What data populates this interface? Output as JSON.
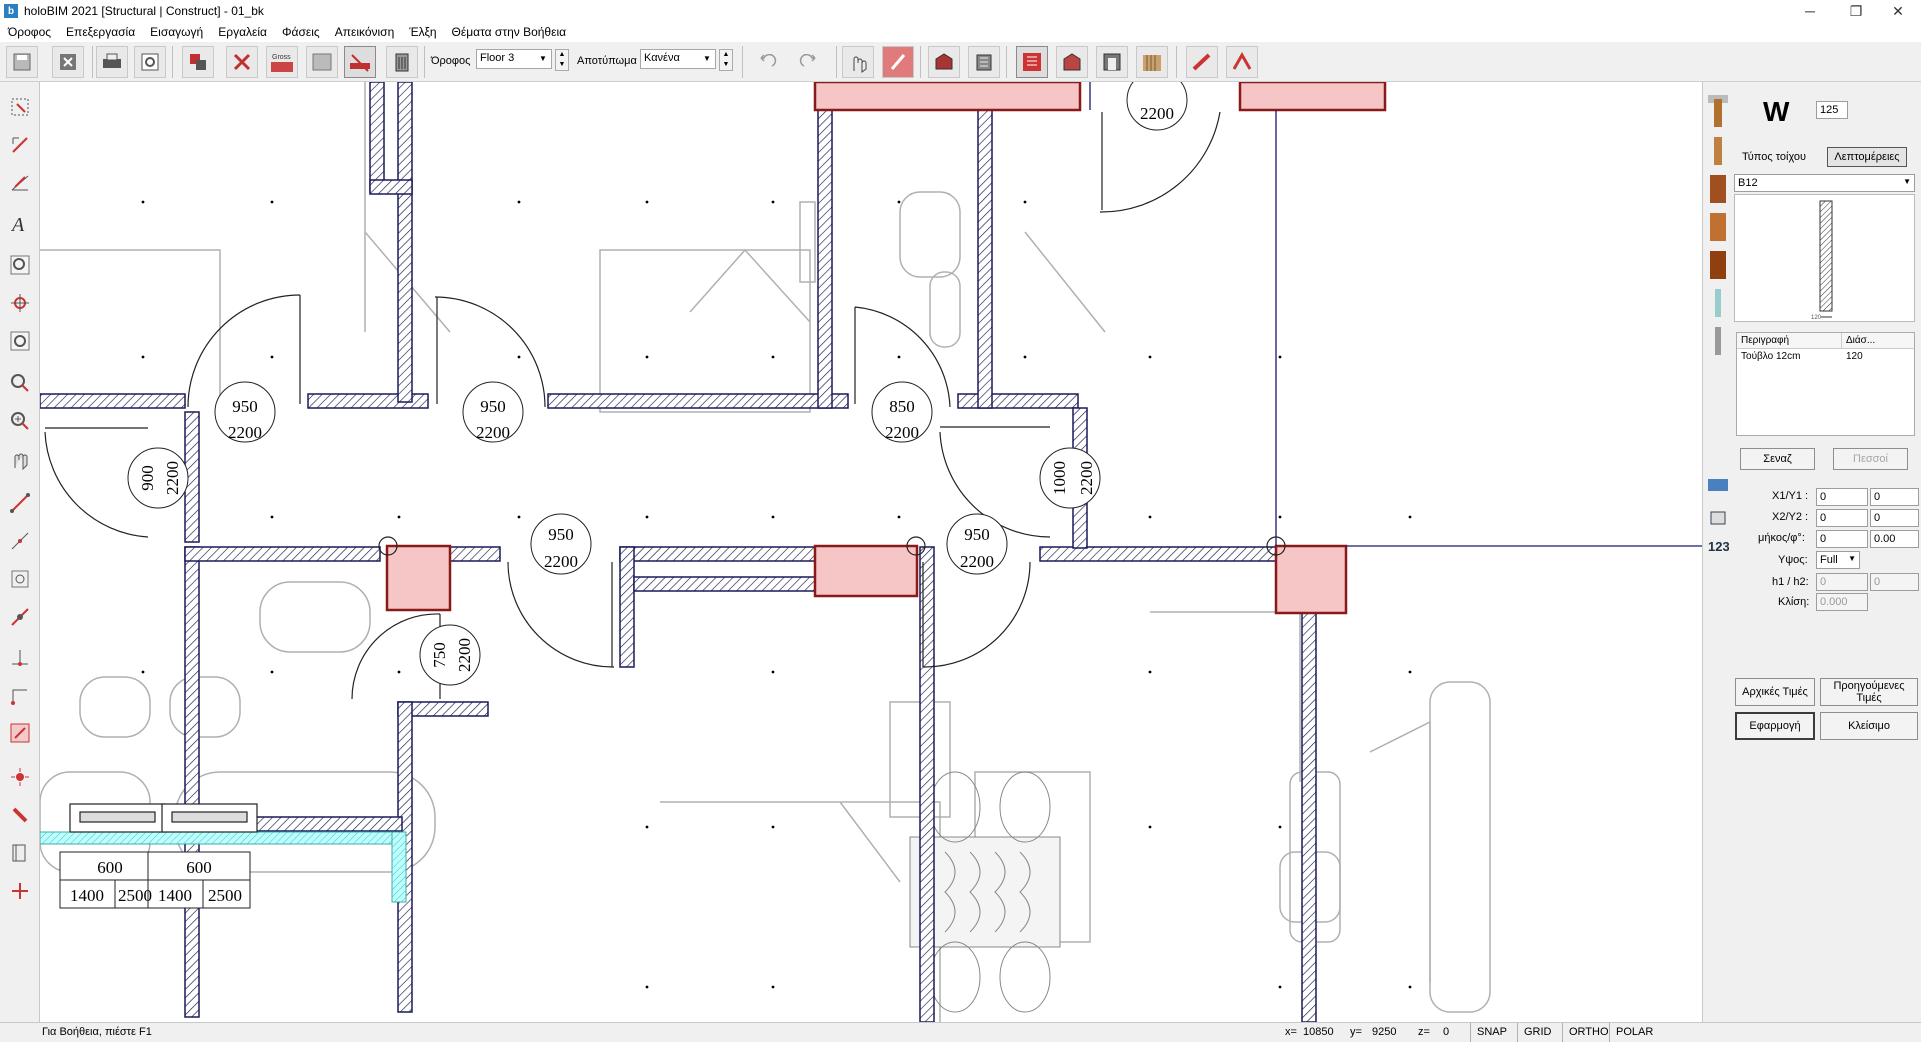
{
  "window": {
    "app_icon": "b",
    "title": "holoBIM 2021 [Structural | Construct] - 01_bk"
  },
  "window_controls": [
    "─",
    "❐",
    "✕"
  ],
  "menu": [
    "Όροφος",
    "Επεξεργασία",
    "Εισαγωγή",
    "Εργαλεία",
    "Φάσεις",
    "Απεικόνιση",
    "Έλξη",
    "Θέματα στην Βοήθεια"
  ],
  "toolbar": {
    "floor_label": "Όροφος",
    "floor_value": "Floor 3",
    "footprint_label": "Αποτύπωμα",
    "footprint_value": "Κανένα",
    "gross_label": "Gross\nBetoni"
  },
  "props": {
    "wall_letter": "W",
    "wall_thickness": "125",
    "wall_type_label": "Τύπος τοίχου",
    "details_button": "Λεπτομέρειες",
    "wall_type_value": "B12",
    "preview_dimension": "120",
    "table_headers": [
      "Περιγραφή",
      "Διάσ..."
    ],
    "table_rows": [
      [
        "Τούβλο 12cm",
        "120"
      ]
    ],
    "layer_button": "Σεναζ",
    "ppost_button": "Πεσσοί",
    "x1y1_label": "X1/Y1 :",
    "x1y1": [
      "0",
      "0"
    ],
    "x2y2_label": "X2/Y2 :",
    "x2y2": [
      "0",
      "0"
    ],
    "length_label": "μήκος/φ°:",
    "length": [
      "0",
      "0.00"
    ],
    "height_label": "Υψος:",
    "height_value": "Full",
    "h1h2_label": "h1 / h2:",
    "h1h2": [
      "0",
      "0"
    ],
    "slope_label": "Κλίση:",
    "slope_value": "0.000",
    "initial_values_button": "Αρχικές Τιμές",
    "previous_values_button": "Προηγούμενες Τιμές",
    "apply_button": "Εφαρμογή",
    "close_button": "Κλείσιμο"
  },
  "dimensions": {
    "d1": [
      "950",
      "2200"
    ],
    "d2": [
      "950",
      "2200"
    ],
    "d3": [
      "850",
      "2200"
    ],
    "d4": [
      "900",
      "2200"
    ],
    "d5": [
      "1000",
      "2200"
    ],
    "d6": [
      "950",
      "2200"
    ],
    "d7": [
      "950",
      "2200"
    ],
    "d8": [
      "750",
      "2200"
    ],
    "d9": [
      "1000",
      "2200"
    ],
    "windows": [
      "600",
      "600",
      "1400",
      "2500",
      "1400",
      "2500"
    ]
  },
  "status": {
    "help": "Για Βοήθεια, πιέστε F1",
    "x_label": "x=",
    "x": "10850",
    "y_label": "y=",
    "y": "9250",
    "z_label": "z=",
    "z": "0",
    "toggles": [
      "SNAP",
      "GRID",
      "ORTHO",
      "POLAR"
    ]
  }
}
